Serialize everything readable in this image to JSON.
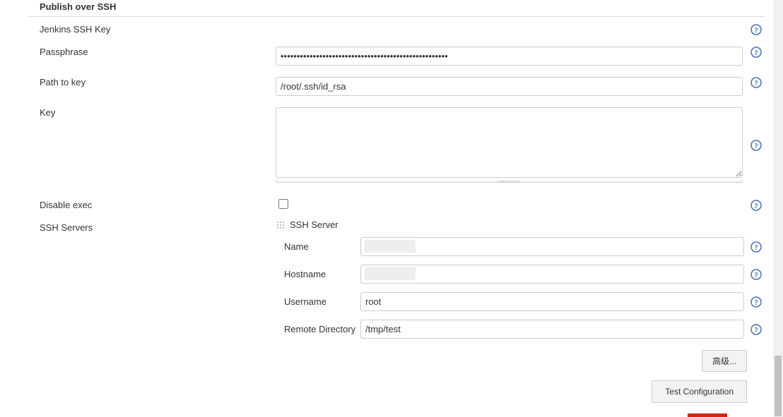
{
  "section": {
    "title": "Publish over SSH"
  },
  "fields": {
    "jenkins_ssh_key_label": "Jenkins SSH Key",
    "passphrase_label": "Passphrase",
    "passphrase_value": "••••••••••••••••••••••••••••••••••••••••••••••••••••",
    "path_label": "Path to key",
    "path_value": "/root/.ssh/id_rsa",
    "key_label": "Key",
    "key_value": "",
    "disable_exec_label": "Disable exec",
    "ssh_servers_label": "SSH Servers"
  },
  "server": {
    "header": "SSH Server",
    "name_label": "Name",
    "name_value": "",
    "hostname_label": "Hostname",
    "hostname_value": "",
    "username_label": "Username",
    "username_value": "root",
    "remote_dir_label": "Remote Directory",
    "remote_dir_value": "/tmp/test"
  },
  "buttons": {
    "advanced": "高级...",
    "test_config": "Test Configuration"
  }
}
